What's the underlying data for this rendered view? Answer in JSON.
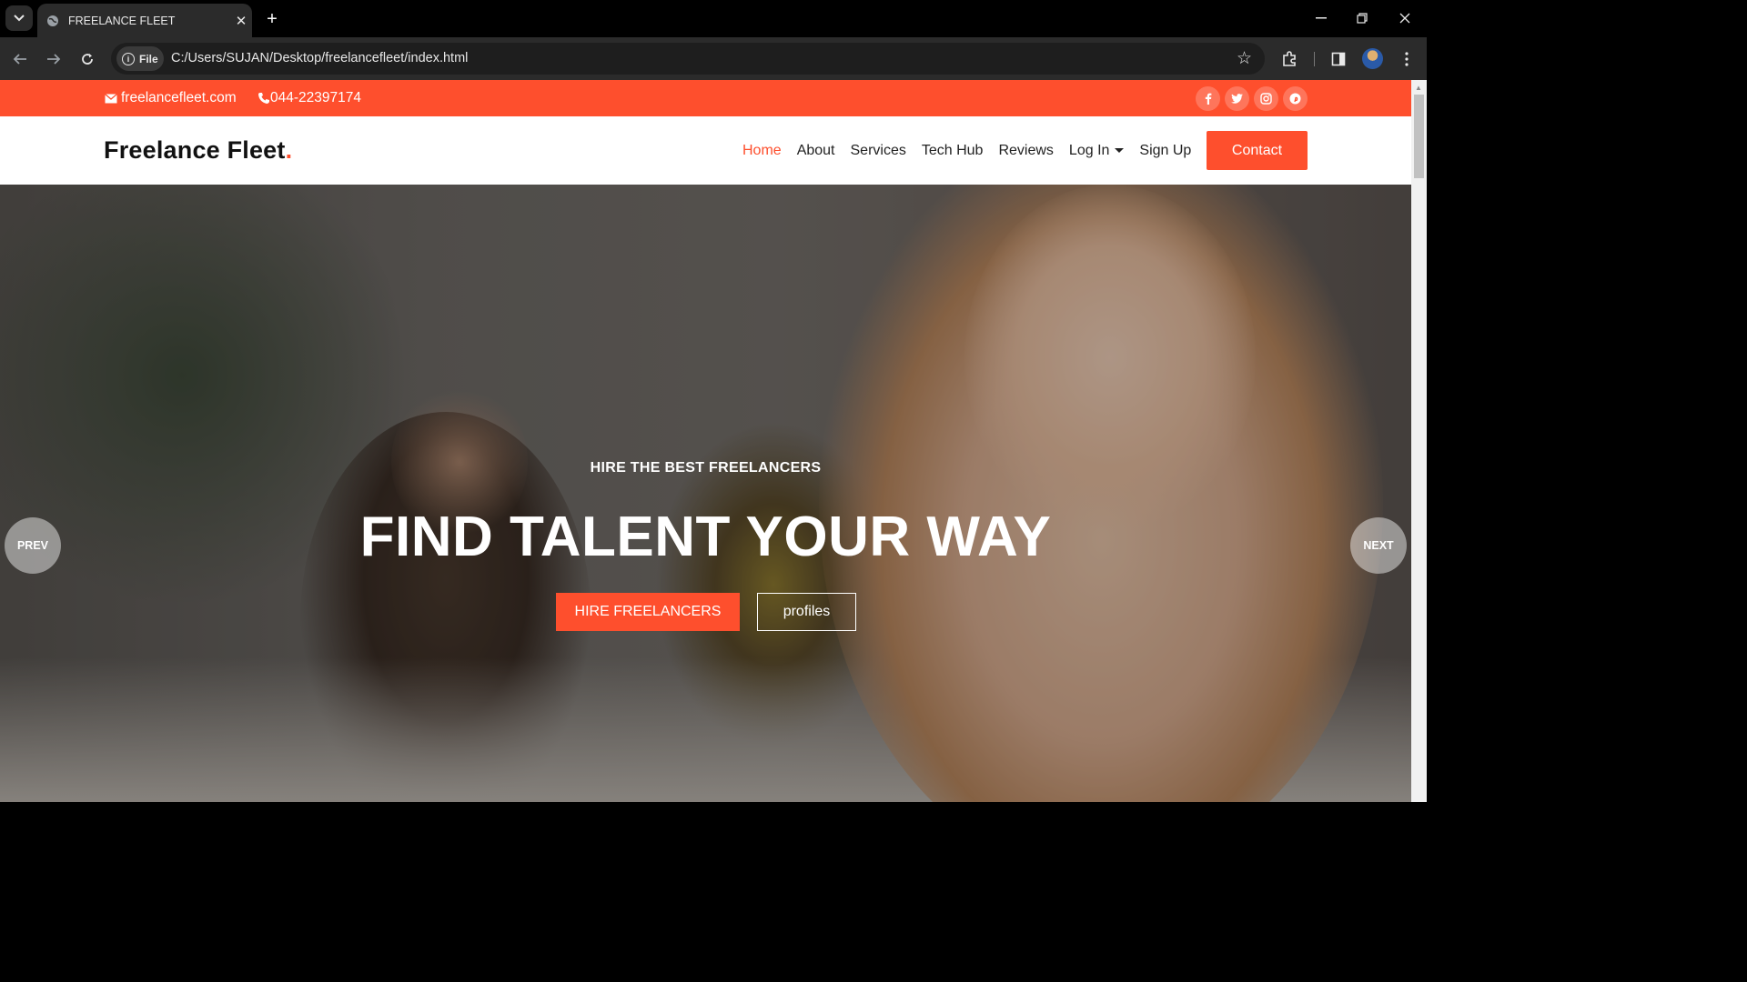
{
  "browser": {
    "tab_title": "FREELANCE FLEET",
    "tab_close": "✕",
    "new_tab": "+",
    "file_label": "File",
    "url": "C:/Users/SUJAN/Desktop/freelancefleet/index.html"
  },
  "topbar": {
    "email": "freelancefleet.com",
    "phone": "044-22397174",
    "socials": [
      "f",
      "t",
      "ig",
      "p"
    ]
  },
  "navbar": {
    "brand": "Freelance Fleet",
    "brand_dot": ".",
    "menu": [
      "Home",
      "About",
      "Services",
      "Tech Hub",
      "Reviews",
      "Log In",
      "Sign Up"
    ],
    "active": "Home",
    "contact_button": "Contact"
  },
  "hero": {
    "subtitle": "HIRE THE BEST FREELANCERS",
    "title": "FIND TALENT YOUR WAY",
    "primary_button": "HIRE FREELANCERS",
    "secondary_button": "profiles",
    "prev": "PREV",
    "next": "NEXT"
  },
  "colors": {
    "accent": "#fe4f2d"
  }
}
